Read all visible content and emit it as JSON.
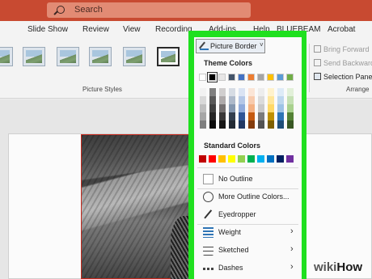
{
  "search": {
    "placeholder": "Search"
  },
  "ribbon_tabs": [
    "Slide Show",
    "Review",
    "View",
    "Recording",
    "Add-ins",
    "Help",
    "BLUEBEAM",
    "Acrobat"
  ],
  "ribbon": {
    "picture_styles_label": "Picture Styles",
    "arrange_label": "Arrange",
    "arrange_items": [
      "Bring Forward",
      "Send Backward",
      "Selection Pane"
    ]
  },
  "picture_border": {
    "button_label": "Picture Border",
    "theme_colors_title": "Theme Colors",
    "theme_colors": [
      "#ffffff",
      "#000000",
      "#e7e6e6",
      "#44546a",
      "#4472c4",
      "#ed7d31",
      "#a5a5a5",
      "#ffc000",
      "#5b9bd5",
      "#70ad47"
    ],
    "selected_theme_color_index": 1,
    "shades": [
      [
        "#f2f2f2",
        "#d9d9d9",
        "#bfbfbf",
        "#a6a6a6",
        "#808080"
      ],
      [
        "#7f7f7f",
        "#595959",
        "#404040",
        "#262626",
        "#0d0d0d"
      ],
      [
        "#d0cece",
        "#aeaaaa",
        "#757171",
        "#3a3838",
        "#161616"
      ],
      [
        "#d6dce4",
        "#adb9ca",
        "#8497b0",
        "#333f4f",
        "#222a35"
      ],
      [
        "#dae3f3",
        "#b4c7e7",
        "#8faadc",
        "#2f5597",
        "#203864"
      ],
      [
        "#fbe5d6",
        "#f8cbad",
        "#f4b183",
        "#c55a11",
        "#843c0c"
      ],
      [
        "#ededed",
        "#dbdbdb",
        "#c9c9c9",
        "#7b7b7b",
        "#525252"
      ],
      [
        "#fff2cc",
        "#ffe699",
        "#ffd966",
        "#bf9000",
        "#7f6000"
      ],
      [
        "#deebf7",
        "#bdd7ee",
        "#9dc3e6",
        "#2e75b6",
        "#1f4e79"
      ],
      [
        "#e2f0d9",
        "#c5e0b4",
        "#a9d18e",
        "#548235",
        "#385723"
      ]
    ],
    "standard_colors_title": "Standard Colors",
    "standard_colors": [
      "#c00000",
      "#ff0000",
      "#ffc000",
      "#ffff00",
      "#92d050",
      "#00b050",
      "#00b0f0",
      "#0070c0",
      "#002060",
      "#7030a0"
    ],
    "menu": [
      {
        "label": "No Outline",
        "icon": "no-outline-icon",
        "has_submenu": false
      },
      {
        "label": "More Outline Colors...",
        "icon": "palette-icon",
        "has_submenu": false
      },
      {
        "label": "Eyedropper",
        "icon": "eyedropper-icon",
        "has_submenu": false
      },
      {
        "label": "Weight",
        "icon": "line-weight-icon",
        "has_submenu": true
      },
      {
        "label": "Sketched",
        "icon": "sketched-line-icon",
        "has_submenu": true
      },
      {
        "label": "Dashes",
        "icon": "dashes-icon",
        "has_submenu": true
      }
    ]
  },
  "watermark": {
    "part1": "wiki",
    "part2": "How"
  },
  "colors": {
    "titlebar": "#c84a31",
    "highlight_frame": "#1fe01f",
    "picture_border_selected": "#c4281c"
  }
}
